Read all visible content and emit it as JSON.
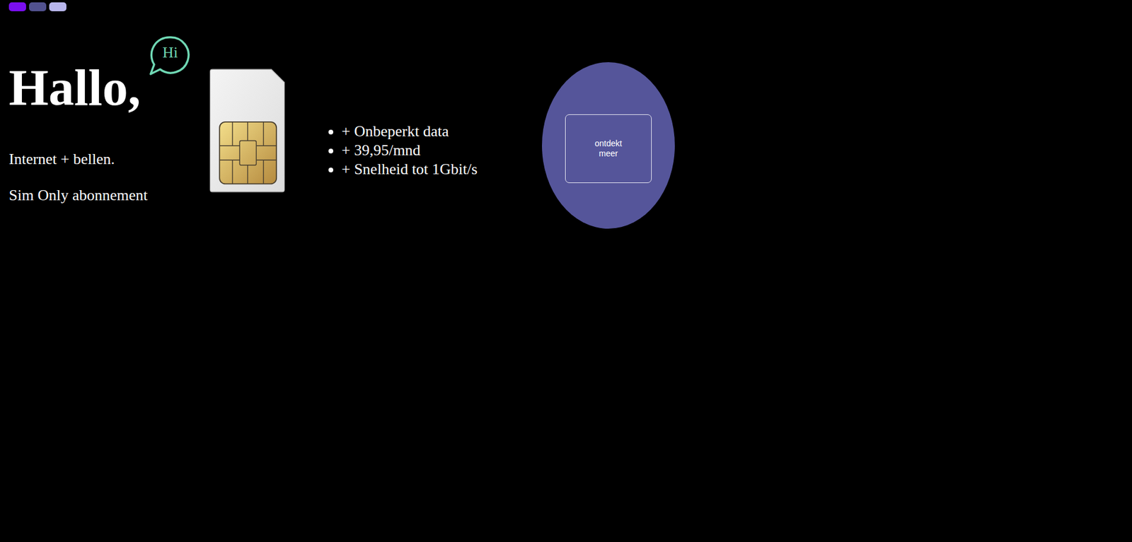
{
  "swatches": [
    {
      "color": "#7a0ff0"
    },
    {
      "color": "#52528f"
    },
    {
      "color": "#b8b6ec"
    }
  ],
  "hero": {
    "title": "Hallo,",
    "bubble": "Hi",
    "lines": [
      "Internet + bellen.",
      "Sim Only abonnement"
    ]
  },
  "features": [
    "+ Onbeperkt data",
    "+ 39,95/mnd",
    "+ Snelheid tot 1Gbit/s"
  ],
  "cta": {
    "label": "ontdekt meer"
  }
}
